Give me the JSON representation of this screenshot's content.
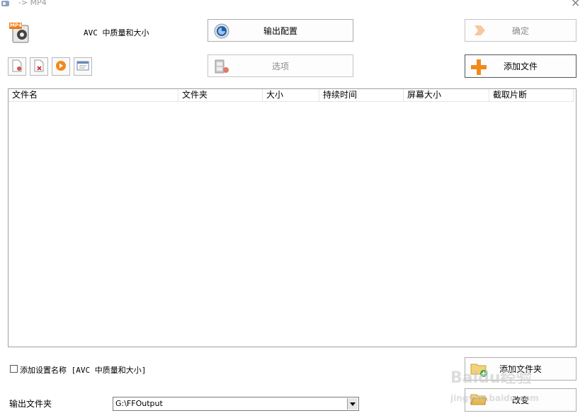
{
  "window": {
    "title": "-> MP4",
    "close_glyph": "×"
  },
  "profile": {
    "icon_label": "MP4",
    "description": "AVC 中质量和大小"
  },
  "buttons": {
    "output_config": "输出配置",
    "confirm": "确定",
    "options": "选项",
    "add_file": "添加文件",
    "add_folder": "添加文件夹",
    "change": "改变"
  },
  "list": {
    "columns": [
      "文件名",
      "文件夹",
      "大小",
      "持续时间",
      "屏幕大小",
      "截取片断"
    ]
  },
  "settings": {
    "add_name_label": "添加设置名称 [AVC 中质量和大小]",
    "add_name_checked": false,
    "output_folder_label": "输出文件夹",
    "output_folder_value": "G:\\FFOutput"
  },
  "watermark": {
    "brand": "Baidu经验",
    "url": "jingyan.baidu.com"
  },
  "colors": {
    "add_plus": "#f08a1c",
    "output_config_icon": "#1e5fa8",
    "disabled_text": "#8a8a8a"
  }
}
